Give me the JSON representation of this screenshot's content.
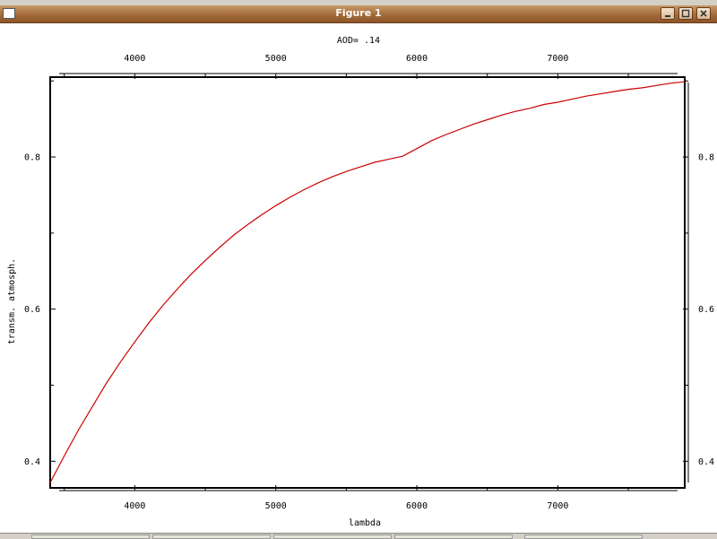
{
  "window": {
    "title": "Figure 1"
  },
  "colors": {
    "line": "#cc0000",
    "titlebar": "#a46b3a"
  },
  "icons": {
    "minimize": "minimize-icon",
    "maximize": "maximize-icon",
    "close": "close-icon"
  },
  "chart_data": {
    "type": "line",
    "title": "AOD= .14",
    "xlabel": "lambda",
    "ylabel": "transm. atmosph.",
    "xlim": [
      3400,
      7900
    ],
    "ylim": [
      0.365,
      0.905
    ],
    "xticks": [
      4000,
      5000,
      6000,
      7000
    ],
    "yticks": [
      0.4,
      0.6,
      0.8
    ],
    "ytick_labels": [
      "0.4",
      "0.6",
      "0.8"
    ],
    "grid": false,
    "series": [
      {
        "x": [
          3400,
          3500,
          3600,
          3700,
          3800,
          3900,
          4000,
          4100,
          4200,
          4300,
          4400,
          4500,
          4600,
          4700,
          4800,
          4900,
          5000,
          5100,
          5200,
          5300,
          5400,
          5500,
          5600,
          5700,
          5800,
          5900,
          6000,
          6100,
          6200,
          6300,
          6400,
          6500,
          6600,
          6700,
          6800,
          6900,
          7000,
          7100,
          7200,
          7300,
          7400,
          7500,
          7600,
          7700,
          7800,
          7900
        ],
        "y": [
          0.372,
          0.407,
          0.441,
          0.472,
          0.503,
          0.531,
          0.557,
          0.582,
          0.605,
          0.626,
          0.646,
          0.664,
          0.681,
          0.697,
          0.711,
          0.724,
          0.736,
          0.747,
          0.757,
          0.766,
          0.774,
          0.781,
          0.787,
          0.793,
          0.797,
          0.801,
          0.811,
          0.821,
          0.829,
          0.836,
          0.843,
          0.849,
          0.855,
          0.86,
          0.864,
          0.869,
          0.872,
          0.876,
          0.88,
          0.883,
          0.886,
          0.889,
          0.891,
          0.894,
          0.897,
          0.899
        ]
      }
    ]
  }
}
